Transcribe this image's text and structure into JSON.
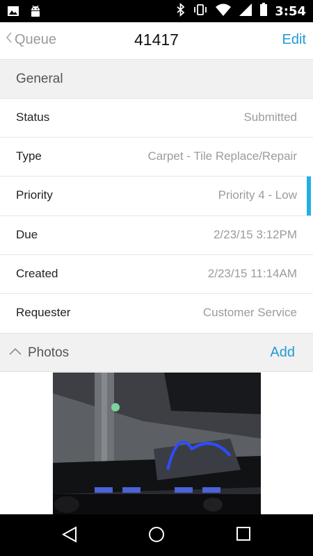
{
  "status_bar": {
    "time": "3:54",
    "left_icons": [
      "image-icon",
      "android-icon"
    ],
    "right_icons": [
      "bluetooth-icon",
      "vibrate-icon",
      "wifi-icon",
      "signal-icon",
      "battery-icon"
    ]
  },
  "header": {
    "back_label": "Queue",
    "title": "41417",
    "edit_label": "Edit"
  },
  "general": {
    "section_label": "General",
    "rows": [
      {
        "label": "Status",
        "value": "Submitted"
      },
      {
        "label": "Type",
        "value": "Carpet - Tile Replace/Repair"
      },
      {
        "label": "Priority",
        "value": "Priority 4 - Low"
      },
      {
        "label": "Due",
        "value": "2/23/15 3:12PM"
      },
      {
        "label": "Created",
        "value": "2/23/15 11:14AM"
      },
      {
        "label": "Requester",
        "value": "Customer Service"
      }
    ]
  },
  "photos": {
    "section_label": "Photos",
    "add_label": "Add"
  },
  "colors": {
    "accent": "#1e9bd7",
    "scroll_indicator": "#1fb0e6",
    "section_bg": "#f1f1f1"
  },
  "nav_bar": {
    "buttons": [
      "back-icon",
      "home-icon",
      "recents-icon"
    ]
  }
}
